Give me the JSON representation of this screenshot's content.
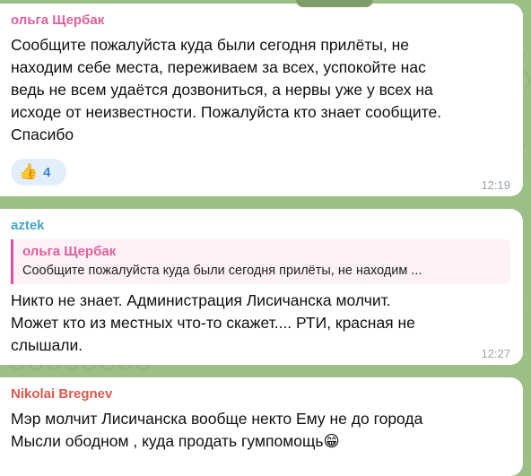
{
  "colors": {
    "background": "#9cbf86",
    "bubble": "#ffffff",
    "author1": "#e0609f",
    "author2": "#4aa6c4",
    "author3": "#d85a4e",
    "reaction_bg": "#e2eefa",
    "reaction_count": "#3a86cf",
    "time": "#9aa4ab"
  },
  "messages": [
    {
      "author": "ольга Щербак",
      "lines": [
        "Сообщите пожалуйста куда были сегодня прилёты, не",
        "находим  себе места, переживаем за всех,  успокойте нас",
        "ведь не всем удаётся дозвониться, а нервы уже у всех на",
        "исходе от неизвестности. Пожалуйста кто знает сообщите.",
        "Спасибо"
      ],
      "reaction": {
        "icon": "thumbs-up-icon",
        "emoji": "👍",
        "count": "4"
      },
      "time": "12:19"
    },
    {
      "author": "aztek",
      "reply": {
        "author": "ольга Щербак",
        "text": "Сообщите пожалуйста куда были сегодня прилёты, не находим ..."
      },
      "lines": [
        "Никто не знает. Администрация Лисичанска молчит.",
        "Может кто из местных что-то скажет.... РТИ, красная не",
        "слышали."
      ],
      "time": "12:27"
    },
    {
      "author": "Nikolai Bregnev",
      "lines": [
        "Мэр молчит Лисичанска вообще некто Ему не до города",
        "Мысли ободном , куда продать гумпомощь"
      ],
      "emoji": {
        "icon": "grinning-face-icon",
        "char": "😁"
      }
    }
  ]
}
